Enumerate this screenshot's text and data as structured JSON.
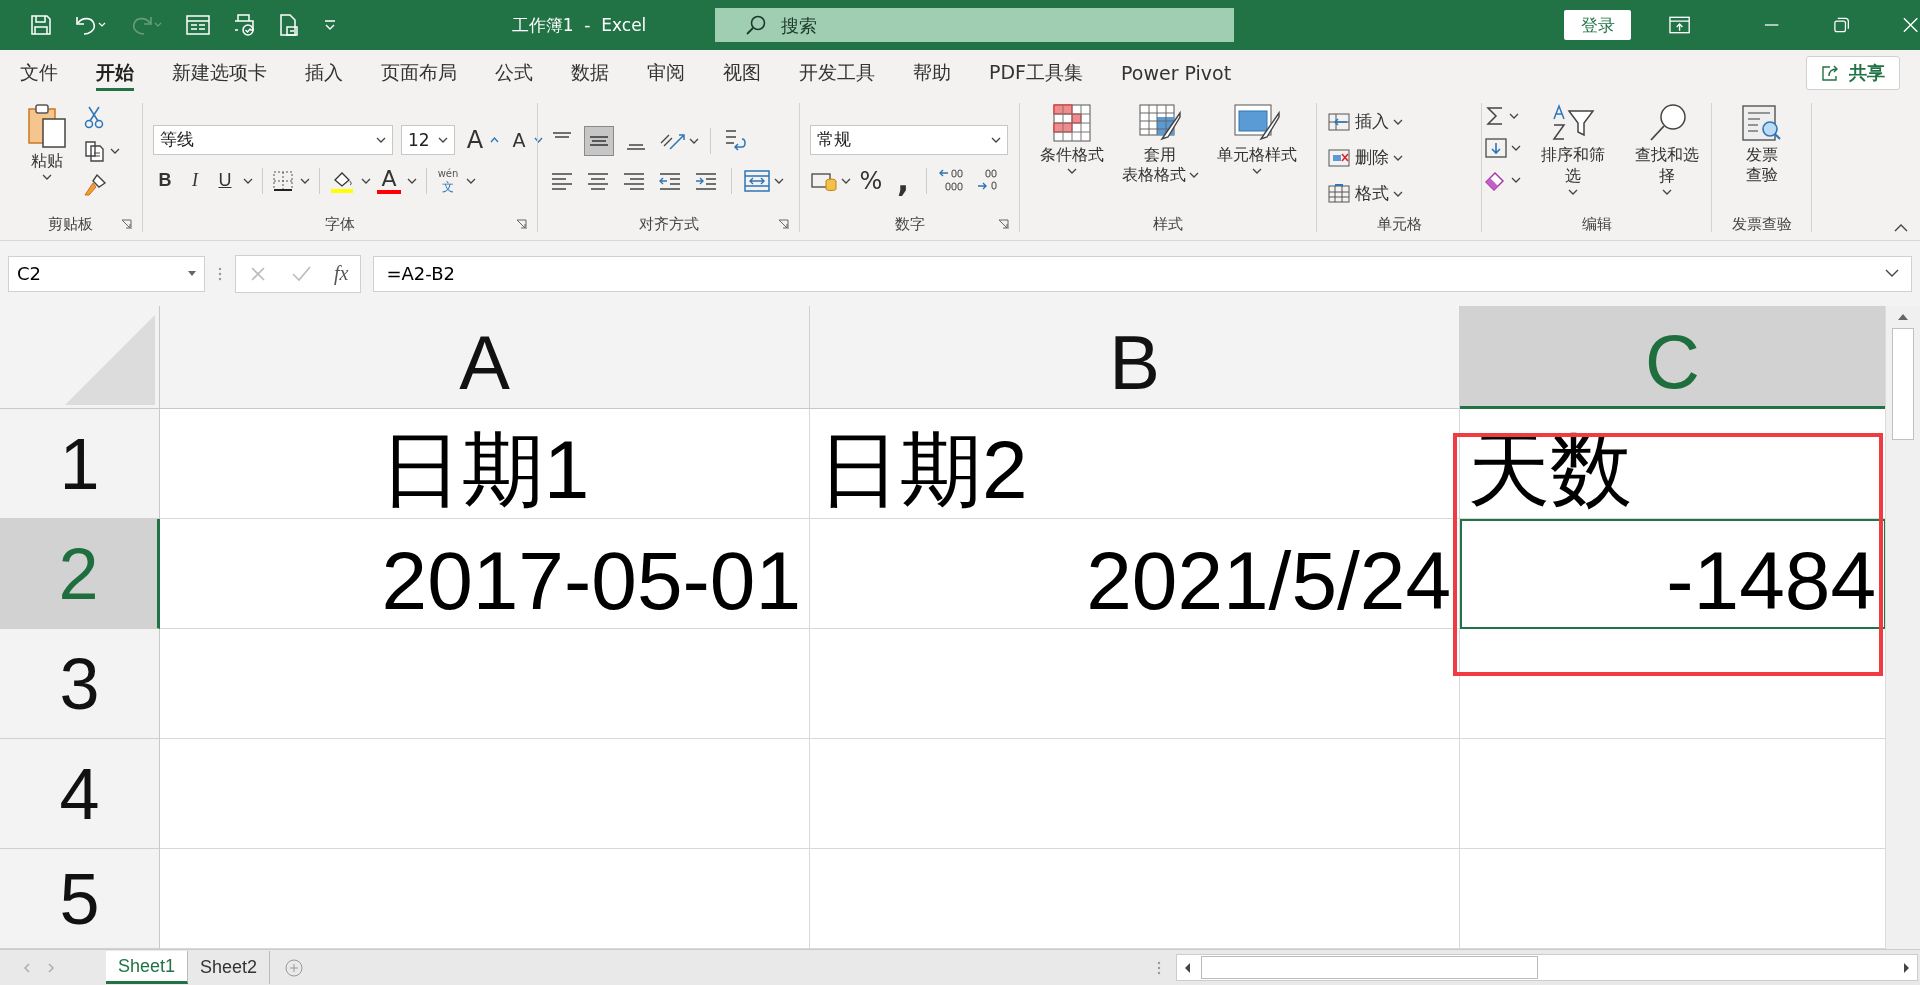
{
  "window": {
    "title": "工作簿1  -  Excel"
  },
  "search": {
    "placeholder": "搜索"
  },
  "account": {
    "login": "登录"
  },
  "tabs": [
    {
      "label": "文件",
      "selected": false
    },
    {
      "label": "开始",
      "selected": true
    },
    {
      "label": "新建选项卡",
      "selected": false
    },
    {
      "label": "插入",
      "selected": false
    },
    {
      "label": "页面布局",
      "selected": false
    },
    {
      "label": "公式",
      "selected": false
    },
    {
      "label": "数据",
      "selected": false
    },
    {
      "label": "审阅",
      "selected": false
    },
    {
      "label": "视图",
      "selected": false
    },
    {
      "label": "开发工具",
      "selected": false
    },
    {
      "label": "帮助",
      "selected": false
    },
    {
      "label": "PDF工具集",
      "selected": false
    },
    {
      "label": "Power Pivot",
      "selected": false
    }
  ],
  "share": "共享",
  "ribbon": {
    "clipboard": {
      "paste": "粘贴",
      "label": "剪贴板"
    },
    "font": {
      "family": "等线",
      "size": "12",
      "grow": "A",
      "shrink": "A",
      "bold": "B",
      "italic": "I",
      "underline": "U",
      "font_color": "A",
      "phonetic_top": "wén",
      "phonetic_bottom": "文",
      "label": "字体"
    },
    "alignment": {
      "label": "对齐方式"
    },
    "number": {
      "format": "常规",
      "percent": "%",
      "comma": ",",
      "label": "数字"
    },
    "styles": {
      "conditional": "条件格式",
      "table_top": "套用",
      "table_bottom": "表格格式",
      "cell_styles": "单元格样式",
      "label": "样式"
    },
    "cells": {
      "insert": "插入",
      "delete": "删除",
      "format": "格式",
      "label": "单元格"
    },
    "editing": {
      "sort": "排序和筛选",
      "find": "查找和选择",
      "label": "编辑"
    },
    "invoice": {
      "check_top": "发票",
      "check_bottom": "查验",
      "label": "发票查验"
    }
  },
  "name_box": "C2",
  "formula_bar": {
    "fx": "fx",
    "formula": "=A2-B2"
  },
  "columns": [
    {
      "label": "A",
      "selected": false
    },
    {
      "label": "B",
      "selected": false
    },
    {
      "label": "C",
      "selected": true
    }
  ],
  "rows": [
    {
      "label": "1",
      "selected": false,
      "cells": [
        {
          "text": "日期1",
          "kind": "centered",
          "selected": false
        },
        {
          "text": "日期2",
          "kind": "text",
          "selected": false
        },
        {
          "text": "天数",
          "kind": "text",
          "selected": false
        }
      ]
    },
    {
      "label": "2",
      "selected": true,
      "cells": [
        {
          "text": "2017-05-01",
          "kind": "number",
          "selected": false
        },
        {
          "text": "2021/5/24",
          "kind": "number",
          "selected": false
        },
        {
          "text": "-1484",
          "kind": "number",
          "selected": true
        }
      ]
    },
    {
      "label": "3",
      "selected": false,
      "cells": []
    },
    {
      "label": "4",
      "selected": false,
      "cells": []
    },
    {
      "label": "5",
      "selected": false,
      "cells": []
    }
  ],
  "sheets": [
    {
      "name": "Sheet1",
      "selected": true
    },
    {
      "name": "Sheet2",
      "selected": false
    }
  ]
}
